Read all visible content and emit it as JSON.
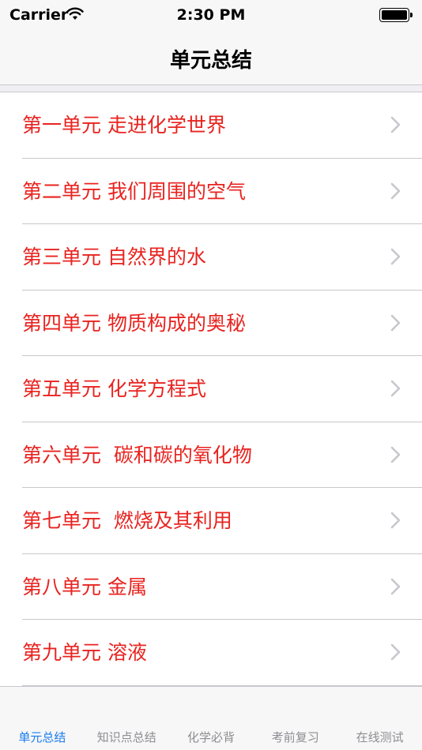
{
  "status_bar": {
    "carrier": "Carrier",
    "time": "2:30 PM"
  },
  "nav": {
    "title": "单元总结"
  },
  "list": {
    "items": [
      {
        "label": "第一单元 走进化学世界"
      },
      {
        "label": "第二单元 我们周围的空气"
      },
      {
        "label": "第三单元 自然界的水"
      },
      {
        "label": "第四单元 物质构成的奥秘"
      },
      {
        "label": "第五单元 化学方程式"
      },
      {
        "label": "第六单元  碳和碳的氧化物"
      },
      {
        "label": "第七单元  燃烧及其利用"
      },
      {
        "label": "第八单元 金属"
      },
      {
        "label": "第九单元 溶液"
      }
    ]
  },
  "tabs": {
    "items": [
      {
        "label": "单元总结",
        "active": true
      },
      {
        "label": "知识点总结",
        "active": false
      },
      {
        "label": "化学必背",
        "active": false
      },
      {
        "label": "考前复习",
        "active": false
      },
      {
        "label": "在线测试",
        "active": false
      }
    ]
  },
  "colors": {
    "item_text": "#e8231f",
    "tab_active": "#1a7cf0",
    "tab_inactive": "#8e8e93",
    "chevron": "#c7c7cc"
  }
}
